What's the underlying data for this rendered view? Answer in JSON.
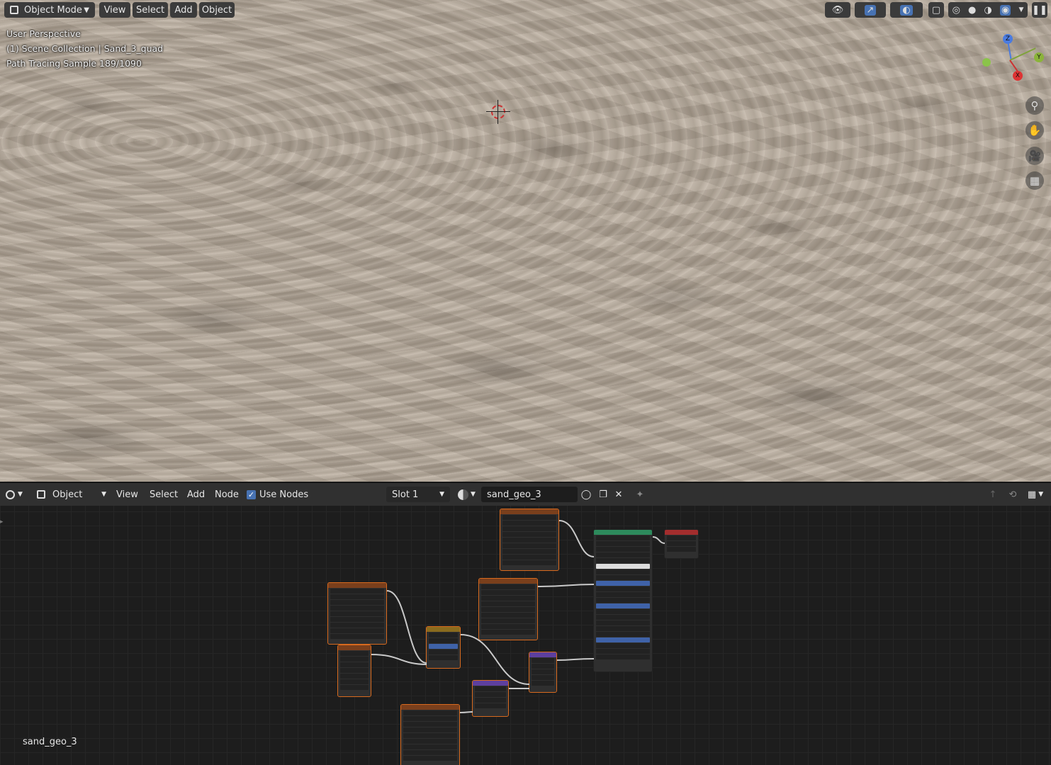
{
  "viewport": {
    "mode_label": "Object Mode",
    "menu": [
      "View",
      "Select",
      "Add",
      "Object"
    ],
    "info": {
      "line1": "User Perspective",
      "line2": "(1) Scene Collection | Sand_3_quad",
      "line3": "Path Tracing Sample 189/1090"
    },
    "gizmo_axes": {
      "x": "X",
      "y": "Y",
      "z": "Z"
    },
    "tools": [
      "zoom-icon",
      "hand-pan-icon",
      "camera-icon",
      "grid-ortho-icon"
    ]
  },
  "node_editor": {
    "editor_type_icon": "shader-editor-icon",
    "object_label": "Object",
    "menu": [
      "View",
      "Select",
      "Add",
      "Node"
    ],
    "use_nodes_label": "Use Nodes",
    "use_nodes_checked": true,
    "slot_label": "Slot 1",
    "material_name": "sand_geo_3",
    "footer_material_label": "sand_geo_3"
  },
  "colors": {
    "texture_node_border": "#d86a1e",
    "bsdf_header": "#2d8a5c",
    "output_header": "#a32d2d",
    "accent": "#4772b3"
  }
}
